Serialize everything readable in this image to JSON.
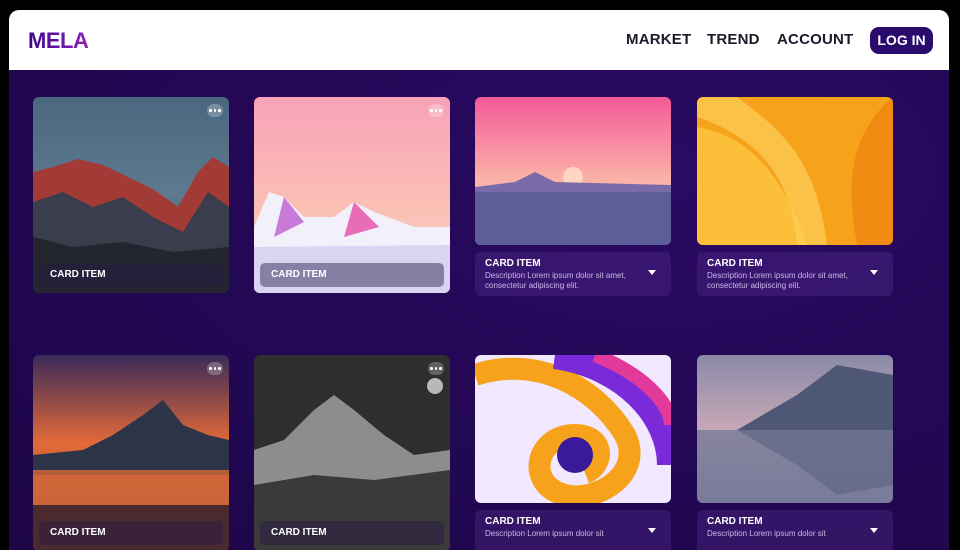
{
  "header": {
    "logo": "MELA",
    "nav": [
      "MARKET",
      "TREND",
      "ACCOUNT"
    ],
    "login_label": "LOG IN"
  },
  "cards": [
    {
      "title": "CARD ITEM",
      "style": "overlay",
      "image": "red-mountain-photo"
    },
    {
      "title": "CARD ITEM",
      "style": "overlay",
      "image": "pink-lowpoly-mountain"
    },
    {
      "title": "CARD ITEM",
      "style": "info",
      "image": "pink-sunset-lake",
      "description": "Description Lorem ipsum dolor sit amet, consectetur adipiscing elit."
    },
    {
      "title": "CARD ITEM",
      "style": "info",
      "image": "orange-abstract-waves",
      "description": "Description Lorem ipsum dolor sit amet, consectetur adipiscing elit."
    },
    {
      "title": "CARD ITEM",
      "style": "overlay",
      "image": "sunset-mountain-reflection"
    },
    {
      "title": "CARD ITEM",
      "style": "overlay",
      "image": "grey-mountain-moon"
    },
    {
      "title": "CARD ITEM",
      "style": "info",
      "image": "colorful-swirl-abstract",
      "description": "Description Lorem ipsum dolor sit"
    },
    {
      "title": "CARD ITEM",
      "style": "info",
      "image": "misty-lake-mountain",
      "description": "Description Lorem ipsum dolor sit"
    }
  ]
}
